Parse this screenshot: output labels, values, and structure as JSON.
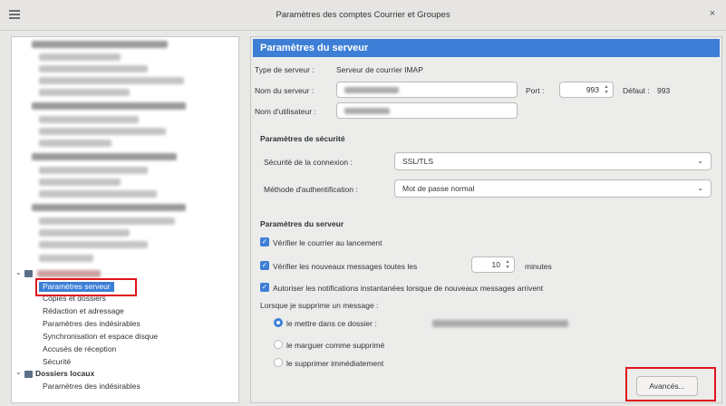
{
  "window": {
    "title": "Paramètres des comptes Courrier et Groupes",
    "close_glyph": "×"
  },
  "tree": {
    "items": [
      {
        "label": "Paramètres serveur",
        "selected": true
      },
      {
        "label": "Copies et dossiers"
      },
      {
        "label": "Rédaction et adressage"
      },
      {
        "label": "Paramètres des indésirables"
      },
      {
        "label": "Synchronisation et espace disque"
      },
      {
        "label": "Accusés de réception"
      },
      {
        "label": "Sécurité"
      }
    ],
    "local_folders_label": "Dossiers locaux",
    "local_child_label": "Paramètres des indésirables"
  },
  "panel": {
    "header": "Paramètres du serveur",
    "server_type_label": "Type de serveur :",
    "server_type_value": "Serveur de courrier IMAP",
    "server_name_label": "Nom du serveur :",
    "port_label": "Port :",
    "port_value": "993",
    "default_label": "Défaut :",
    "default_value": "993",
    "username_label": "Nom d'utilisateur :",
    "security_section": "Paramètres de sécurité",
    "connection_security_label": "Sécurité de la connexion :",
    "connection_security_value": "SSL/TLS",
    "auth_method_label": "Méthode d'authentification :",
    "auth_method_value": "Mot de passe normal",
    "server_section": "Paramètres du serveur",
    "check_on_start": "Vérifier le courrier au lancement",
    "check_every": "Vérifier les nouveaux messages toutes les",
    "check_every_value": "10",
    "minutes_label": "minutes",
    "allow_push": "Autoriser les notifications instantanées lorsque de nouveaux messages arrivent",
    "on_delete_label": "Lorsque je supprime un message :",
    "move_to_folder": "le mettre dans ce dossier :",
    "mark_deleted": "le marguer comme supprimé",
    "delete_immediately": "le supprimer immédiatement",
    "advanced_button": "Avancés..."
  },
  "colors": {
    "accent": "#3d7fd6",
    "highlight_box": "#e0141b"
  }
}
